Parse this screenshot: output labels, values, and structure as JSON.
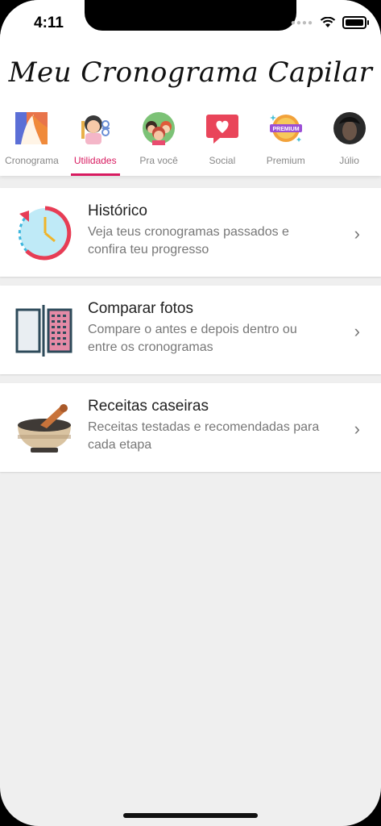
{
  "status_bar": {
    "time": "4:11"
  },
  "header": {
    "title": "Meu Cronograma Capilar"
  },
  "tabs": [
    {
      "label": "Cronograma",
      "icon": "cronograma-icon"
    },
    {
      "label": "Utilidades",
      "icon": "utilidades-icon",
      "active": true
    },
    {
      "label": "Pra você",
      "icon": "pra-voce-icon"
    },
    {
      "label": "Social",
      "icon": "social-heart-icon"
    },
    {
      "label": "Premium",
      "icon": "premium-badge-icon"
    },
    {
      "label": "Júlio",
      "icon": "profile-avatar"
    }
  ],
  "cards": [
    {
      "title": "Histórico",
      "description": "Veja teus cronogramas passados e confira teu progresso",
      "icon": "history-clock-icon"
    },
    {
      "title": "Comparar fotos",
      "description": "Compare o antes e depois dentro ou entre os cronogramas",
      "icon": "compare-photos-icon"
    },
    {
      "title": "Receitas caseiras",
      "description": "Receitas testadas e recomendadas para cada etapa",
      "icon": "mortar-pestle-icon"
    }
  ],
  "colors": {
    "accent": "#d81b60",
    "background": "#efefef"
  }
}
